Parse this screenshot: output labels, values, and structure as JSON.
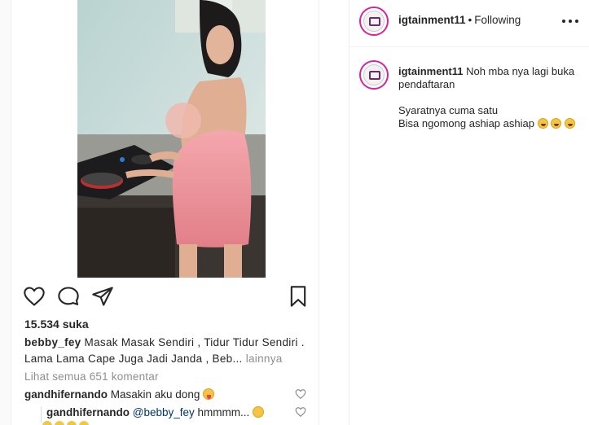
{
  "post": {
    "likes_text": "15.534 suka",
    "caption": {
      "username": "bebby_fey",
      "text_line1": "Masak Masak Sendiri , Tidur Tidur Sendiri .",
      "text_line2": "Lama Lama Cape Juga Jadi Janda , Beb...",
      "more_label": "lainnya"
    },
    "view_all_comments": "Lihat semua 651 komentar",
    "comments": [
      {
        "username": "gandhifernando",
        "text": "Masakin aku dong"
      }
    ],
    "replies": [
      {
        "username": "gandhifernando",
        "mention": "@bebby_fey",
        "text": "hmmmm..."
      }
    ]
  },
  "icons": {
    "like": "heart-outline-icon",
    "comment": "speech-bubble-icon",
    "share": "paper-plane-icon",
    "save": "bookmark-icon",
    "comment_like": "small-heart-icon",
    "emoji_tongue": "winking-tongue-emoji",
    "emoji_thinking": "thinking-face-emoji",
    "emoji_laugh": "rolling-laughing-emoji"
  },
  "side": {
    "header": {
      "username": "igtainment11",
      "separator": "•",
      "follow_status": "Following"
    },
    "post_caption": {
      "username": "igtainment11",
      "line1": "Noh mba nya lagi buka pendaftaran",
      "line2": "Syaratnya cuma satu",
      "line3": "Bisa ngomong ashiap ashiap"
    }
  },
  "colors": {
    "text": "#262626",
    "muted": "#8e8e8e",
    "border": "#efefef",
    "mention": "#003569",
    "avatar_ring": "#d6249f"
  }
}
